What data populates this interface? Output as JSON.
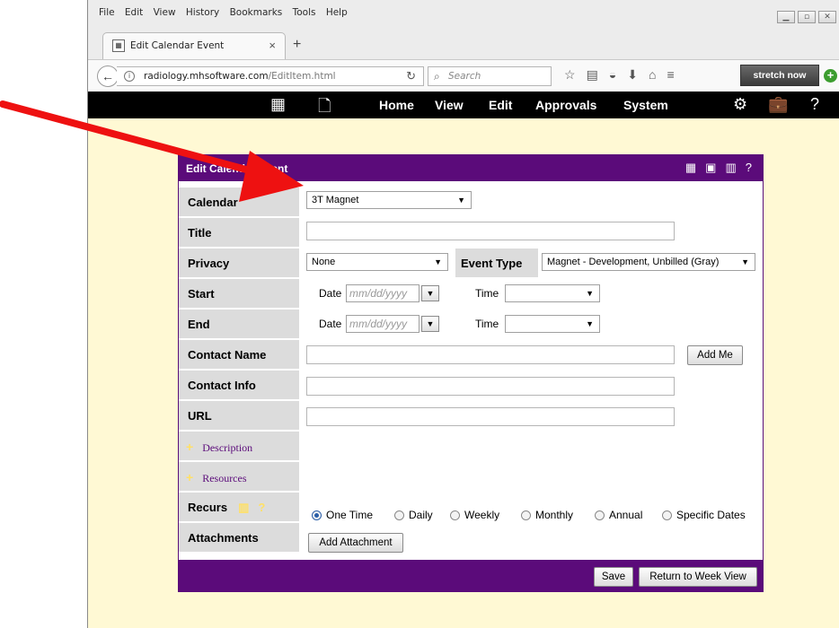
{
  "browser": {
    "menus": [
      "File",
      "Edit",
      "View",
      "History",
      "Bookmarks",
      "Tools",
      "Help"
    ],
    "tab_title": "Edit Calendar Event",
    "tab_close": "×",
    "new_tab": "+",
    "url_domain": "radiology.mhsoftware.com",
    "url_path": "/EditItem.html",
    "search_placeholder": "Search",
    "stretch_label": "stretch now"
  },
  "app_nav": {
    "items": [
      "Home",
      "View",
      "Edit",
      "Approvals",
      "System"
    ]
  },
  "form": {
    "title": "Edit Calendar Event",
    "labels": {
      "calendar": "Calendar",
      "title": "Title",
      "privacy": "Privacy",
      "start": "Start",
      "end": "End",
      "contact_name": "Contact Name",
      "contact_info": "Contact Info",
      "url": "URL",
      "description": "Description",
      "resources": "Resources",
      "recurs": "Recurs",
      "attachments": "Attachments"
    },
    "calendar_value": "3T Magnet",
    "privacy_value": "None",
    "event_type_label": "Event Type",
    "event_type_value": "Magnet - Development, Unbilled (Gray)",
    "date_label": "Date",
    "time_label": "Time",
    "date_placeholder": "mm/dd/yyyy",
    "add_me": "Add Me",
    "recurrence": [
      "One Time",
      "Daily",
      "Weekly",
      "Monthly",
      "Annual",
      "Specific Dates"
    ],
    "recurrence_selected": "One Time",
    "add_attachment": "Add Attachment",
    "save": "Save",
    "return": "Return to Week View"
  },
  "colors": {
    "panel_purple": "#5b0b7a",
    "page_background": "#fff9d4",
    "annotation_arrow": "#ee1111"
  }
}
